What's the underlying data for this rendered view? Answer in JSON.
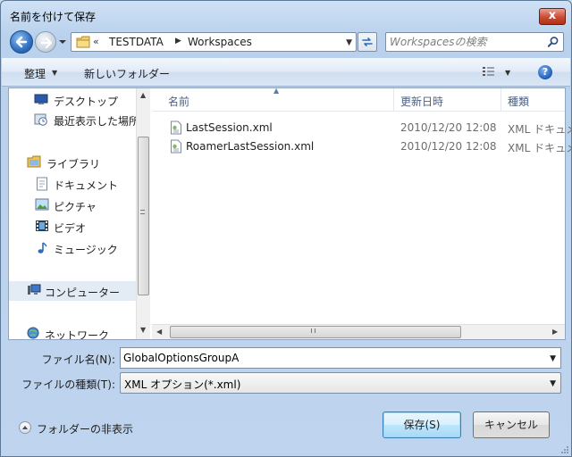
{
  "window": {
    "title": "名前を付けて保存",
    "close_label": "x"
  },
  "address": {
    "overflow": "«",
    "breadcrumbs": [
      "TESTDATA",
      "Workspaces"
    ],
    "search_placeholder": "Workspacesの検索"
  },
  "toolbar": {
    "organize": "整理",
    "new_folder": "新しいフォルダー"
  },
  "nav": {
    "items": [
      {
        "label": "デスクトップ",
        "icon": "desktop-icon"
      },
      {
        "label": "最近表示した場所",
        "icon": "recent-places-icon"
      },
      {
        "label": "ライブラリ",
        "icon": "library-icon"
      },
      {
        "label": "ドキュメント",
        "icon": "documents-icon"
      },
      {
        "label": "ピクチャ",
        "icon": "pictures-icon"
      },
      {
        "label": "ビデオ",
        "icon": "videos-icon"
      },
      {
        "label": "ミュージック",
        "icon": "music-icon"
      },
      {
        "label": "コンピューター",
        "icon": "computer-icon"
      },
      {
        "label": "ネットワーク",
        "icon": "network-icon"
      }
    ]
  },
  "files": {
    "columns": [
      "名前",
      "更新日時",
      "種類"
    ],
    "rows": [
      {
        "name": "LastSession.xml",
        "modified": "2010/12/20 12:08",
        "type": "XML ドキュメント"
      },
      {
        "name": "RoamerLastSession.xml",
        "modified": "2010/12/20 12:08",
        "type": "XML ドキュメント"
      }
    ]
  },
  "form": {
    "filename_label": "ファイル名(N):",
    "filename_value": "GlobalOptionsGroupA",
    "filetype_label": "ファイルの種類(T):",
    "filetype_value": "XML オプション(*.xml)"
  },
  "footer": {
    "hide_folders": "フォルダーの非表示",
    "save_label": "保存(S)",
    "cancel_label": "キャンセル"
  }
}
